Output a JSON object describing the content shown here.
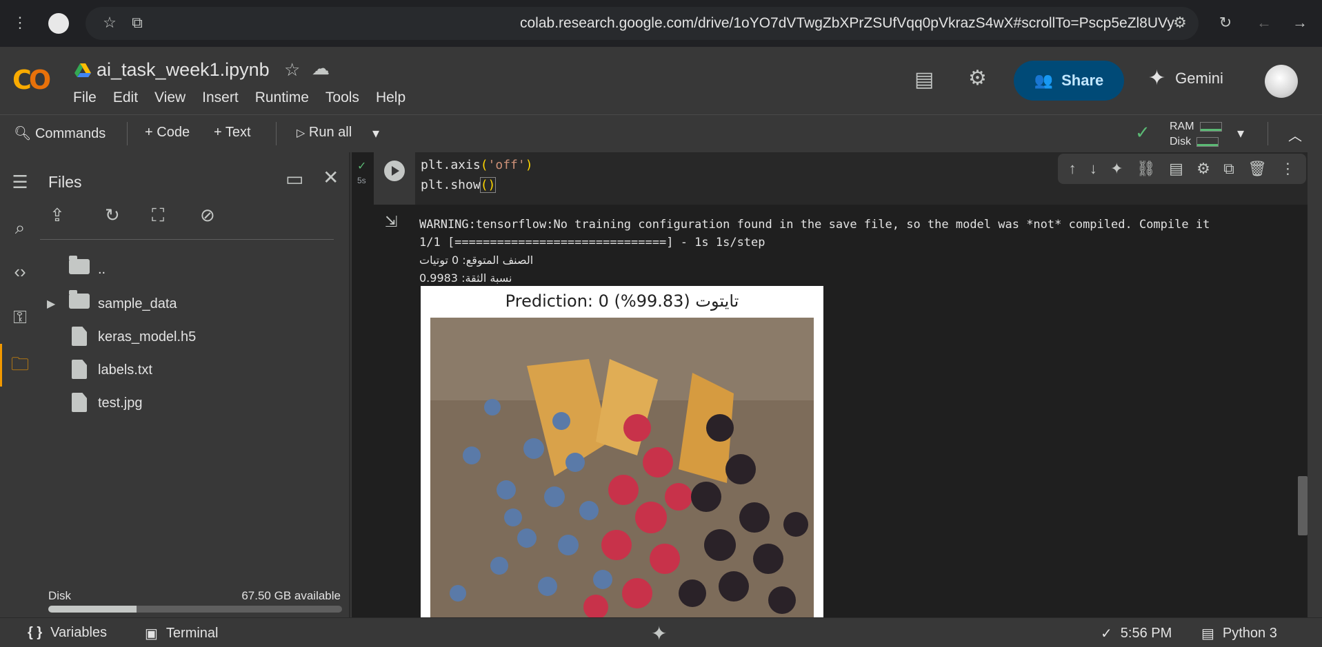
{
  "browser": {
    "url": "colab.research.google.com/drive/1oYO7dVTwgZbXPrZSUfVqq0pVkrazS4wX#scrollTo=Pscp5eZl8UVy"
  },
  "header": {
    "notebook_title": "ai_task_week1.ipynb",
    "menu": [
      "File",
      "Edit",
      "View",
      "Insert",
      "Runtime",
      "Tools",
      "Help"
    ],
    "share_label": "Share",
    "gemini_label": "Gemini"
  },
  "toolbar": {
    "commands_label": "Commands",
    "code_label": "Code",
    "text_label": "Text",
    "run_all_label": "Run all",
    "ram_label": "RAM",
    "disk_label": "Disk"
  },
  "files_panel": {
    "title": "Files",
    "items": [
      {
        "name": "..",
        "type": "folder-up"
      },
      {
        "name": "sample_data",
        "type": "folder"
      },
      {
        "name": "keras_model.h5",
        "type": "file"
      },
      {
        "name": "labels.txt",
        "type": "file"
      },
      {
        "name": "test.jpg",
        "type": "file"
      }
    ],
    "disk_label": "Disk",
    "disk_available": "67.50 GB available",
    "disk_used_fraction": 0.3
  },
  "cell": {
    "exec_time": "5s",
    "code_line1_prefix": "plt.axis",
    "code_line1_arg": "'off'",
    "code_line2": "plt.show",
    "output_line1": "WARNING:tensorflow:No training configuration found in the save file, so the model was *not* compiled. Compile it",
    "output_line2": "1/1 [==============================] - 1s 1s/step",
    "output_line3": "الصنف المتوقع: 0 توتيات",
    "output_line4": "نسبة الثقة: 0.9983",
    "figure_title": "Prediction: 0 تايتوت (99.83%)"
  },
  "statusbar": {
    "variables_label": "Variables",
    "terminal_label": "Terminal",
    "time": "5:56 PM",
    "runtime": "Python 3"
  },
  "colors": {
    "accent_share": "#004a77",
    "check_green": "#5bb974",
    "logo_orange": "#f9ab00"
  }
}
